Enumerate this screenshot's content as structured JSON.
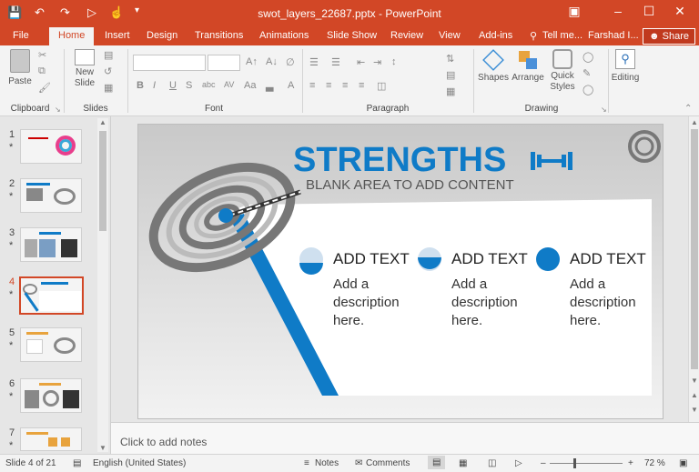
{
  "app": {
    "window_title": "swot_layers_22687.pptx - PowerPoint"
  },
  "tabs": [
    "File",
    "Home",
    "Insert",
    "Design",
    "Transitions",
    "Animations",
    "Slide Show",
    "Review",
    "View",
    "Add-ins"
  ],
  "tell_me": "Tell me...",
  "user_name": "Farshad I...",
  "share_label": "Share",
  "ribbon": {
    "paste_label": "Paste",
    "new_slide_label": "New Slide",
    "shapes_label": "Shapes",
    "arrange_label": "Arrange",
    "quick_styles_label": "Quick Styles",
    "editing_label": "Editing",
    "groups": {
      "clipboard": "Clipboard",
      "slides": "Slides",
      "font": "Font",
      "paragraph": "Paragraph",
      "drawing": "Drawing"
    }
  },
  "thumbnails": [
    {
      "num": "1",
      "star": "*"
    },
    {
      "num": "2",
      "star": "*"
    },
    {
      "num": "3",
      "star": "*"
    },
    {
      "num": "4",
      "star": "*"
    },
    {
      "num": "5",
      "star": "*"
    },
    {
      "num": "6",
      "star": "*"
    },
    {
      "num": "7",
      "star": "*"
    }
  ],
  "slide": {
    "heading": "STRENGTHS",
    "subheading": "BLANK AREA TO ADD CONTENT",
    "items": [
      {
        "title": "ADD TEXT",
        "desc": [
          "Add a",
          "description",
          "here."
        ],
        "fill": 0.33
      },
      {
        "title": "ADD TEXT",
        "desc": [
          "Add a",
          "description",
          "here."
        ],
        "fill": 0.66
      },
      {
        "title": "ADD TEXT",
        "desc": [
          "Add a",
          "description",
          "here."
        ],
        "fill": 1.0
      }
    ]
  },
  "notes_placeholder": "Click to add notes",
  "status": {
    "slide_info": "Slide 4 of 21",
    "language": "English (United States)",
    "notes_label": "Notes",
    "comments_label": "Comments",
    "zoom": "72 %"
  },
  "colors": {
    "accent": "#d24726",
    "slide_blue": "#0f7bc7"
  }
}
